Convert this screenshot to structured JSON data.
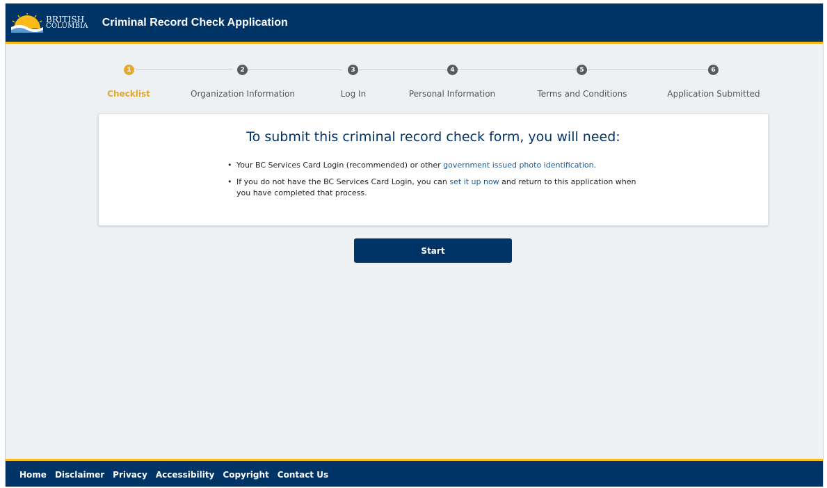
{
  "header": {
    "logo_line1": "BRITISH",
    "logo_line2": "COLUMBIA",
    "app_title": "Criminal Record Check Application"
  },
  "stepper": {
    "steps": [
      {
        "number": "1",
        "label": "Checklist",
        "active": true
      },
      {
        "number": "2",
        "label": "Organization Information",
        "active": false
      },
      {
        "number": "3",
        "label": "Log In",
        "active": false
      },
      {
        "number": "4",
        "label": "Personal Information",
        "active": false
      },
      {
        "number": "5",
        "label": "Terms and Conditions",
        "active": false
      },
      {
        "number": "6",
        "label": "Application Submitted",
        "active": false
      }
    ]
  },
  "card": {
    "title": "To submit this criminal record check form, you will need:",
    "item1_text": "Your BC Services Card Login (recommended) or other ",
    "item1_link": "government issued photo identification",
    "item1_end": ".",
    "item2_text": "If you do not have the BC Services Card Login, you can ",
    "item2_link": "set it up now",
    "item2_end": " and return to this application when you have completed that process."
  },
  "start_button": "Start",
  "footer": {
    "links": [
      "Home",
      "Disclaimer",
      "Privacy",
      "Accessibility",
      "Copyright",
      "Contact Us"
    ]
  },
  "colors": {
    "brand_navy": "#003366",
    "brand_gold": "#fcba19",
    "active_step": "#e3a82b",
    "link": "#1a5a96"
  }
}
